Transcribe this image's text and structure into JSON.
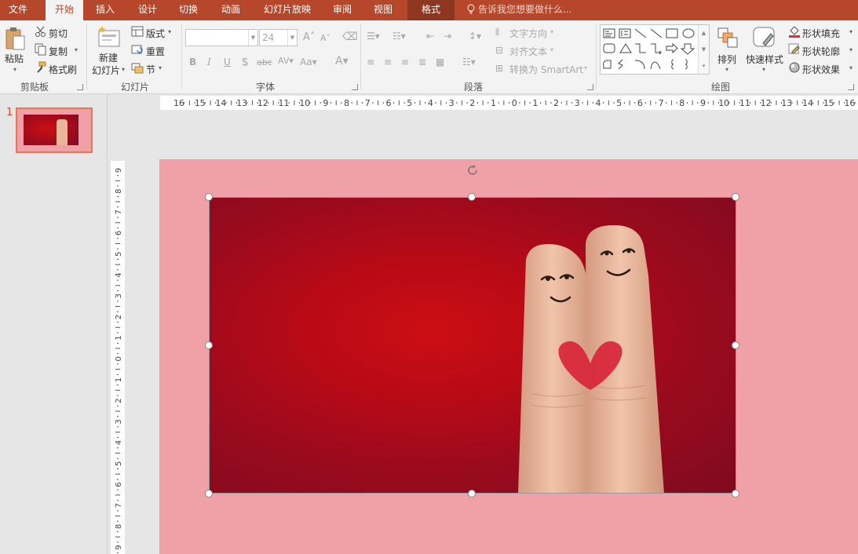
{
  "tabs": [
    {
      "label": "文件",
      "active": false
    },
    {
      "label": "开始",
      "active": true
    },
    {
      "label": "插入",
      "active": false
    },
    {
      "label": "设计",
      "active": false
    },
    {
      "label": "切换",
      "active": false
    },
    {
      "label": "动画",
      "active": false
    },
    {
      "label": "幻灯片放映",
      "active": false
    },
    {
      "label": "审阅",
      "active": false
    },
    {
      "label": "视图",
      "active": false
    },
    {
      "label": "格式",
      "active": false
    }
  ],
  "tell_me": "告诉我您想要做什么...",
  "clipboard": {
    "paste": "粘贴",
    "cut": "剪切",
    "copy": "复制",
    "format_painter": "格式刷",
    "group": "剪贴板"
  },
  "slides": {
    "new_slide_1": "新建",
    "new_slide_2": "幻灯片",
    "layout": "版式",
    "reset": "重置",
    "section": "节",
    "group": "幻灯片"
  },
  "font": {
    "font_name": "",
    "font_size": "24",
    "group": "字体"
  },
  "paragraph": {
    "text_direction": "文字方向",
    "align_text": "对齐文本",
    "convert_smartart": "转换为 SmartArt",
    "group": "段落"
  },
  "drawing": {
    "arrange": "排列",
    "quick_styles": "快速样式",
    "shape_fill": "形状填充",
    "shape_outline": "形状轮廓",
    "shape_effects": "形状效果",
    "group": "绘图"
  },
  "slide_panel": {
    "number": "1"
  },
  "ruler": {
    "h_labels": [
      "16",
      "15",
      "14",
      "13",
      "12",
      "11",
      "10",
      "9",
      "8",
      "7",
      "6",
      "5",
      "4",
      "3",
      "2",
      "1",
      "0",
      "1",
      "2",
      "3",
      "4",
      "5",
      "6",
      "7",
      "8",
      "9",
      "10",
      "11",
      "12",
      "13",
      "14",
      "15",
      "16"
    ],
    "v_labels": [
      "9",
      "8",
      "7",
      "6",
      "5",
      "4",
      "3",
      "2",
      "1",
      "0",
      "1",
      "2",
      "3",
      "4",
      "5",
      "6",
      "7",
      "8",
      "9"
    ]
  },
  "colors": {
    "accent": "#b7472a",
    "slide_bg": "#f0a1a7",
    "picture_red": "#c40c14",
    "heart": "#d8253a"
  }
}
